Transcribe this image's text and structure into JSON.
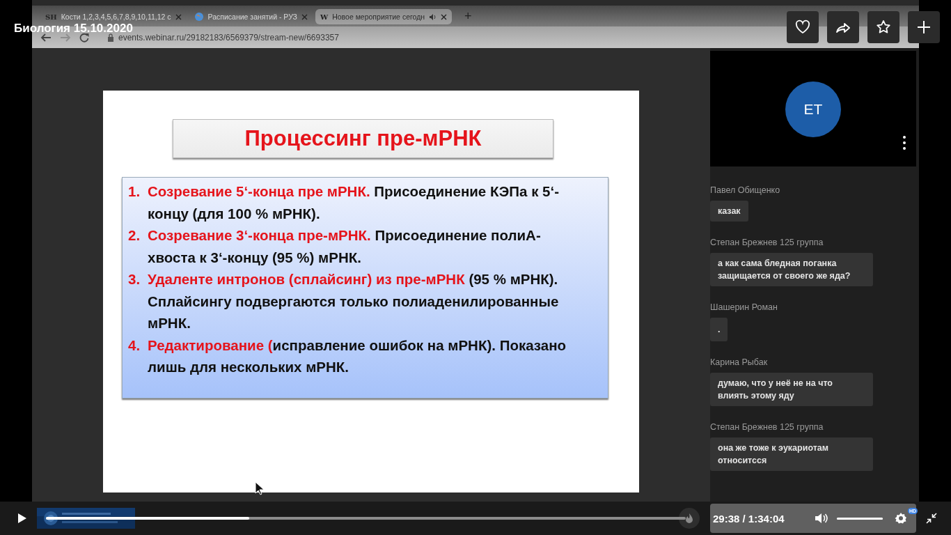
{
  "video_title": "Биология 15.10.2020",
  "browser": {
    "tabs": [
      {
        "favicon_text": "SH",
        "label": "Кости 1,2,3,4,5,6,7,8,9,10,11,12 с",
        "audio": false,
        "selected": false
      },
      {
        "label": "Расписание занятий - РУЗ",
        "audio": false,
        "selected": false
      },
      {
        "favicon_text": "W",
        "label": "Новое мероприятие сегодн",
        "audio": true,
        "selected": true
      }
    ],
    "new_tab": "+",
    "forward_disabled": true,
    "url": "events.webinar.ru/29182183/6569379/stream-new/6693357"
  },
  "slide": {
    "title": "Процессинг пре-мРНК",
    "items": [
      {
        "number": "1.",
        "lead": "Созревание 5‘-конца пре мРНК.",
        "rest": " Присоединение КЭПа к 5‘-концу (для 100 % мРНК)."
      },
      {
        "number": "2.",
        "lead": "Созревание 3‘-конца пре-мРНК.",
        "rest": " Присоединение полиА-хвоста к 3‘-концу (95 %) мРНК."
      },
      {
        "number": "3.",
        "lead": "Удаленте интронов (сплайсинг) из пре-мРНК",
        "rest": " (95 % мРНК). Сплайсингу подвергаются только полиаденилированные мРНК."
      },
      {
        "number": "4.",
        "lead": "Редактирование (",
        "rest": "исправление ошибок на мРНК). Показано лишь для нескольких мРНК."
      }
    ]
  },
  "participant": {
    "initials": "ET"
  },
  "chat": [
    {
      "author": "Павел Обищенко",
      "text": "казак"
    },
    {
      "author": "Степан Брежнев 125 группа",
      "text": "а как сама бледная поганка защищается от своего же яда?"
    },
    {
      "author": "Шашерин Роман",
      "text": "."
    },
    {
      "author": "Карина Рыбак",
      "text": "думаю, что у неё не на что влиять этому яду"
    },
    {
      "author": "Степан Брежнев 125 группа",
      "text": "она же тоже к эукариотам относитсся"
    }
  ],
  "player": {
    "progress": {
      "level": 0.318
    },
    "time": "29:38 / 1:34:04",
    "volume": {
      "level": 1
    },
    "quality_badge": "HD"
  }
}
